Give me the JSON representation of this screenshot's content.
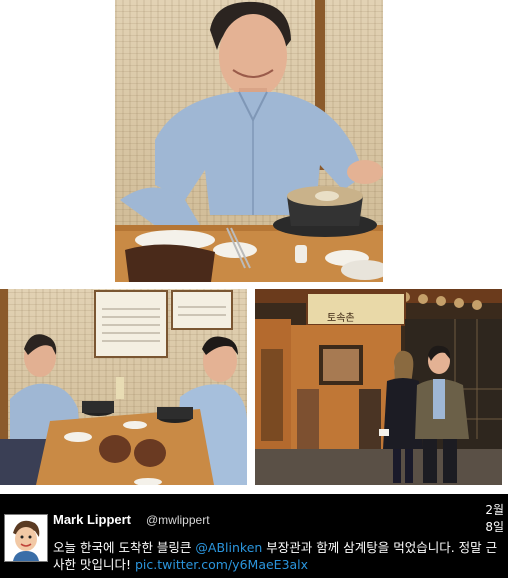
{
  "tweet": {
    "author_name": "Mark Lippert",
    "author_handle": "@mwlippert",
    "date_month": "2월",
    "date_day": "8일",
    "text_before_mention": "오늘 한국에 도착한 블링큰 ",
    "mention": "@ABlinken",
    "text_after_mention": " 부장관과 함께 삼계탕을 먹었습니다. 정말 근사한 맛입니다! ",
    "link": "pic.twitter.com/y6MaeE3alx"
  },
  "photos": {
    "restaurant_sign": "토속촌",
    "wall_notice_title": "토속촌 삼계탕"
  },
  "colors": {
    "tweet_background": "#000000",
    "link_color": "#2b95dc",
    "wall_tan": "#d8c6a5",
    "shirt_blue": "#9fb7d4",
    "table_wood": "#c98a45"
  }
}
